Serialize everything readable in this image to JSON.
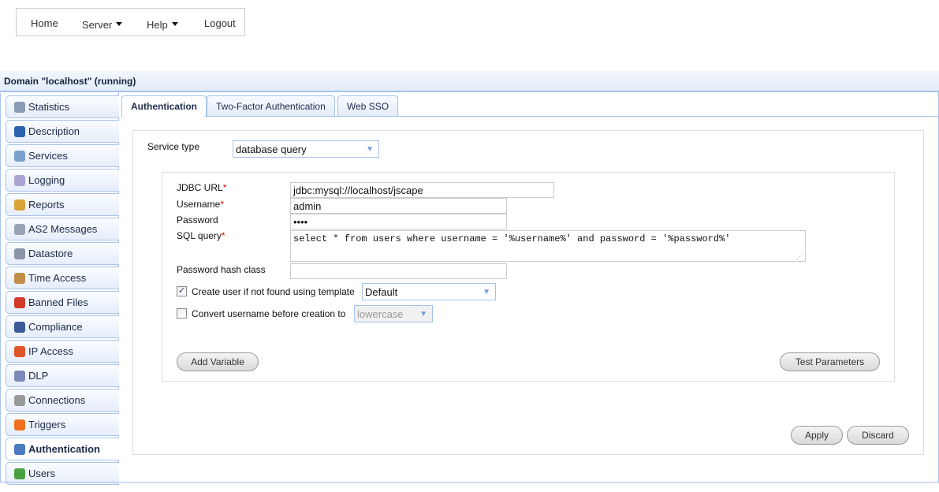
{
  "menu": {
    "items": [
      {
        "label": "Home"
      },
      {
        "label": "Server"
      },
      {
        "label": "Help"
      },
      {
        "label": "Logout"
      }
    ]
  },
  "domain_title": "Domain \"localhost\" (running)",
  "sidebar": {
    "items": [
      {
        "label": "Statistics",
        "icon": "statistics-icon",
        "color": "#8a9bb5"
      },
      {
        "label": "Description",
        "icon": "user-icon",
        "color": "#2b5fb0"
      },
      {
        "label": "Services",
        "icon": "services-icon",
        "color": "#7aa0cc"
      },
      {
        "label": "Logging",
        "icon": "speech-bubble-icon",
        "color": "#a9a4cf"
      },
      {
        "label": "Reports",
        "icon": "bar-chart-icon",
        "color": "#d9a43a"
      },
      {
        "label": "AS2 Messages",
        "icon": "messages-icon",
        "color": "#9aa4b8"
      },
      {
        "label": "Datastore",
        "icon": "database-icon",
        "color": "#8a95a8"
      },
      {
        "label": "Time Access",
        "icon": "clock-icon",
        "color": "#c28e4a"
      },
      {
        "label": "Banned Files",
        "icon": "banned-icon",
        "color": "#d23a2a"
      },
      {
        "label": "Compliance",
        "icon": "compliance-icon",
        "color": "#3a5a9a"
      },
      {
        "label": "IP Access",
        "icon": "firewall-icon",
        "color": "#e0552a"
      },
      {
        "label": "DLP",
        "icon": "shield-icon",
        "color": "#7b88b8"
      },
      {
        "label": "Connections",
        "icon": "gears-icon",
        "color": "#9a9a9a"
      },
      {
        "label": "Triggers",
        "icon": "lightning-icon",
        "color": "#f07020"
      },
      {
        "label": "Authentication",
        "icon": "id-card-icon",
        "color": "#4a7ac0",
        "active": true
      },
      {
        "label": "Users",
        "icon": "user-green-icon",
        "color": "#4aa040"
      }
    ]
  },
  "tabs": [
    {
      "label": "Authentication",
      "active": true
    },
    {
      "label": "Two-Factor Authentication"
    },
    {
      "label": "Web SSO"
    }
  ],
  "form": {
    "service_type_label": "Service type",
    "service_type_value": "database query",
    "jdbc_label": "JDBC URL",
    "jdbc_value": "jdbc:mysql://localhost/jscape",
    "username_label": "Username",
    "username_value": "admin",
    "password_label": "Password",
    "password_value": "••••",
    "sql_label": "SQL query",
    "sql_value": "select * from users where username = '%username%' and password = '%password%'",
    "hash_label": "Password hash class",
    "hash_value": "",
    "create_user_label": "Create user if not found using template",
    "create_user_checked": true,
    "template_value": "Default",
    "convert_label": "Convert username before creation to",
    "convert_checked": false,
    "convert_value": "lowercase",
    "required_mark": "*"
  },
  "buttons": {
    "add_variable": "Add Variable",
    "test_parameters": "Test Parameters",
    "apply": "Apply",
    "discard": "Discard"
  }
}
